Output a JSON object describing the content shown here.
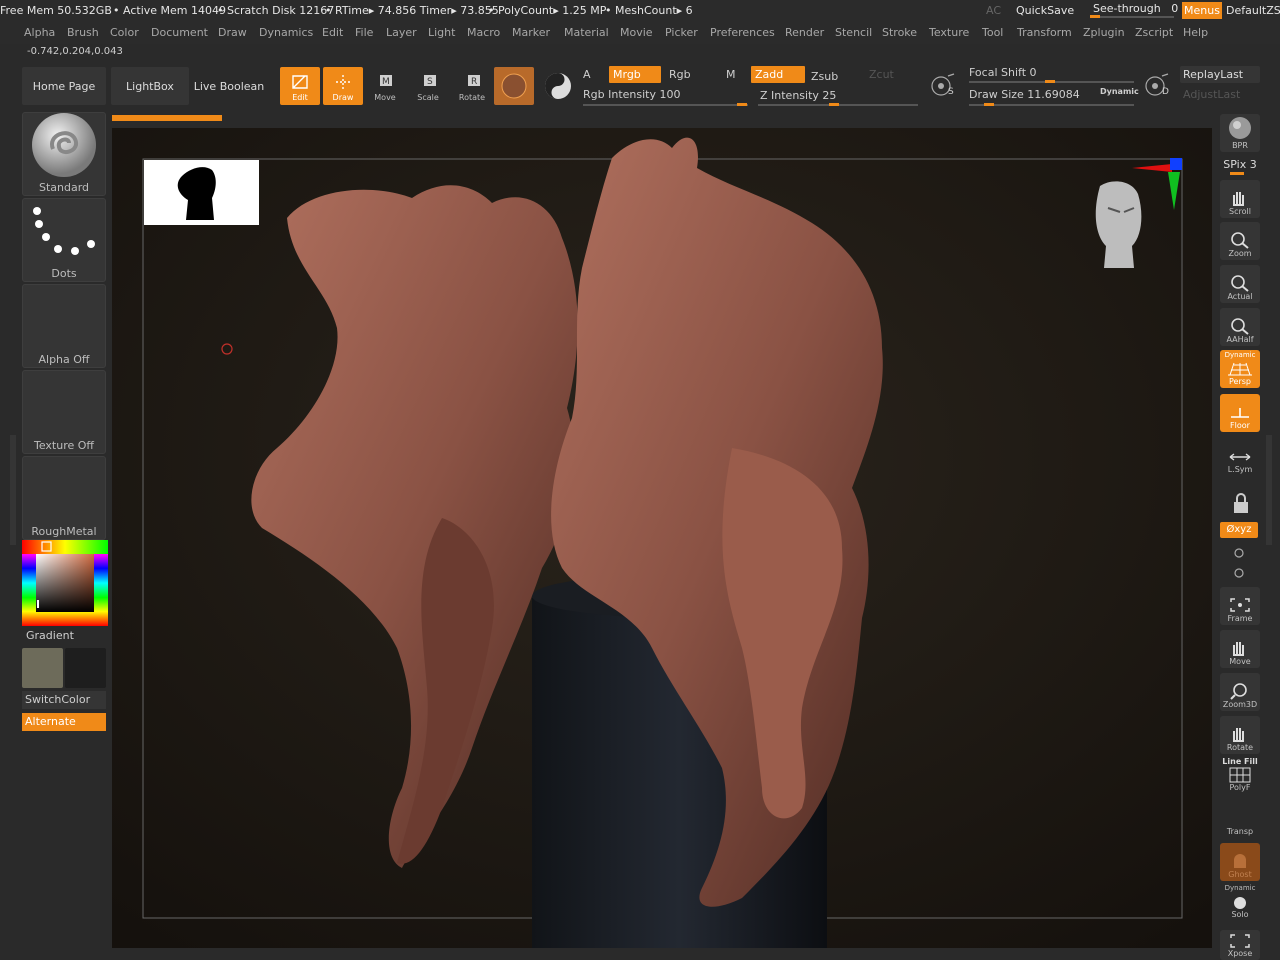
{
  "status": {
    "free_mem": "Free Mem 50.532GB",
    "active_mem": "Active Mem 14049",
    "scratch": "Scratch Disk 12167",
    "rtime": "RTime▸ 74.856 Timer▸ 73.855",
    "polycount": "PolyCount▸ 1.25 MP",
    "meshcount": "MeshCount▸ 6",
    "ac": "AC",
    "quicksave": "QuickSave",
    "seethrough_label": "See-through",
    "seethrough_value": "0",
    "menus": "Menus",
    "default_script": "DefaultZSc"
  },
  "menus": [
    "Alpha",
    "Brush",
    "Color",
    "Document",
    "Draw",
    "Dynamics",
    "Edit",
    "File",
    "Layer",
    "Light",
    "Macro",
    "Marker",
    "Material",
    "Movie",
    "Picker",
    "Preferences",
    "Render",
    "Stencil",
    "Stroke",
    "Texture",
    "Tool",
    "Transform",
    "Zplugin",
    "Zscript",
    "Help"
  ],
  "coords": "-0.742,0.204,0.043",
  "toolbar": {
    "home_page": "Home Page",
    "lightbox": "LightBox",
    "live_boolean": "Live Boolean",
    "edit": "Edit",
    "draw": "Draw",
    "move": "Move",
    "scale": "Scale",
    "rotate": "Rotate",
    "a_label": "A",
    "mrgb": "Mrgb",
    "rgb": "Rgb",
    "m_label": "M",
    "rgb_intensity": "Rgb Intensity 100",
    "zadd": "Zadd",
    "zsub": "Zsub",
    "zcut": "Zcut",
    "z_intensity": "Z Intensity 25",
    "focal_shift": "Focal Shift 0",
    "draw_size": "Draw Size 11.69084",
    "dynamic": "Dynamic",
    "replay_last": "ReplayLast",
    "adjust_last": "AdjustLast",
    "s_label": "S",
    "d_label": "D"
  },
  "left": {
    "standard": "Standard",
    "dots": "Dots",
    "alpha_off": "Alpha Off",
    "texture_off": "Texture Off",
    "roughmetal": "RoughMetal",
    "gradient": "Gradient",
    "switchcolor": "SwitchColor",
    "alternate": "Alternate"
  },
  "right": {
    "bpr": "BPR",
    "spix": "SPix 3",
    "scroll": "Scroll",
    "zoom": "Zoom",
    "actual": "Actual",
    "aahalf": "AAHalf",
    "dynamic_persp": "Dynamic",
    "persp": "Persp",
    "floor": "Floor",
    "lsym": "L.Sym",
    "xyz": "Øxyz",
    "frame": "Frame",
    "move": "Move",
    "zoom3d": "Zoom3D",
    "rotate": "Rotate",
    "line_fill": "Line Fill",
    "polyf": "PolyF",
    "transp": "Transp",
    "ghost": "Ghost",
    "dynamic_solo": "Dynamic",
    "solo": "Solo",
    "xpose": "Xpose"
  },
  "colors": {
    "accent": "#f08a18",
    "panel": "#353535",
    "clay": "#8a5244",
    "viewport_bg": "#1e1914"
  }
}
